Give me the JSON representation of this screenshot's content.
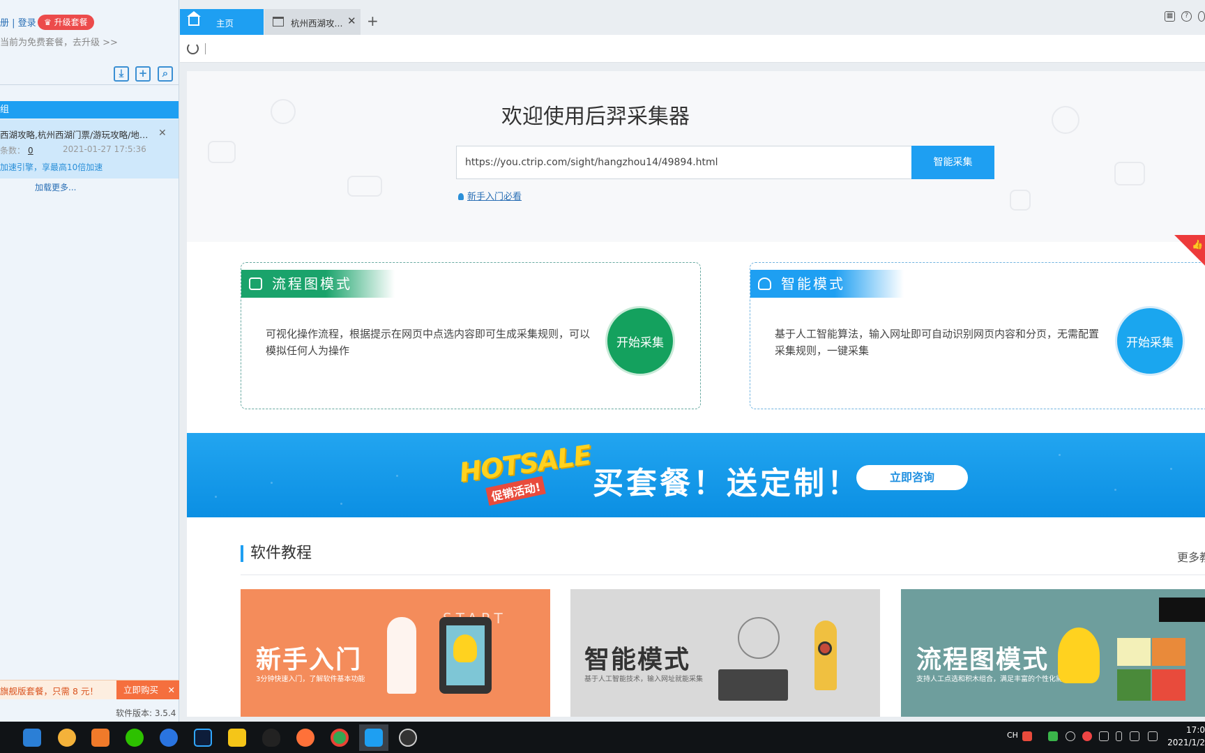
{
  "sidebar": {
    "account_links": "册 | 登录",
    "upgrade_label": "升级套餐",
    "plan_status": "当前为免费套餐，去升级 >>",
    "toolbar": [
      "download-icon",
      "add-icon",
      "search-icon"
    ],
    "group_label": "组",
    "task": {
      "title": "西湖攻略,杭州西湖门票/游玩攻略/地址/...",
      "count_label": "条数：",
      "count_value": "0",
      "time": "2021-01-27 17:5:36",
      "tip": "加速引擎，享最高10倍加速"
    },
    "load_more": "加载更多...",
    "promo_text": "旗舰版套餐，只需 8 元！",
    "buy_label": "立即购买",
    "version": "软件版本: 3.5.4"
  },
  "tabs": [
    {
      "label": "主页",
      "icon": "home-icon",
      "active": true
    },
    {
      "label": "杭州西湖攻...",
      "icon": "page-icon",
      "active": false
    }
  ],
  "main": {
    "title": "欢迎使用后羿采集器",
    "url_value": "https://you.ctrip.com/sight/hangzhou14/49894.html",
    "collect_button": "智能采集",
    "guide_link": "新手入门必看",
    "modes": [
      {
        "name": "流程图模式",
        "description": "可视化操作流程，根据提示在网页中点选内容即可生成采集规则，可以模拟任何人为操作",
        "start_label": "开始采集",
        "color": "#14a15e"
      },
      {
        "name": "智能模式",
        "description": "基于人工智能算法，输入网址即可自动识别网页内容和分页，无需配置采集规则，一键采集",
        "start_label": "开始采集",
        "color": "#1aa6ef"
      }
    ],
    "banner": {
      "hotsale": "HOTSALE",
      "hotsale_sub": "促销活动!",
      "headline": "买套餐！送定制！",
      "cta": "立即咨询"
    },
    "tutorials": {
      "heading": "软件教程",
      "more": "更多教",
      "cards": [
        {
          "title": "新手入门",
          "subtitle": "3分钟快速入门，了解软件基本功能",
          "art_text": "START"
        },
        {
          "title": "智能模式",
          "subtitle": "基于人工智能技术，输入网址就能采集"
        },
        {
          "title": "流程图模式",
          "subtitle": "支持人工点选和积木组合，满足丰富的个性化需求"
        }
      ]
    }
  },
  "taskbar": {
    "apps": [
      "windows-explorer-icon",
      "media-player-icon",
      "app-icon",
      "wechat-icon",
      "browser-b-icon",
      "photoshop-icon",
      "g-app-icon",
      "qq-icon",
      "firefox-icon",
      "chrome-icon",
      "houyi-collector-icon",
      "obs-icon"
    ],
    "ime": "CH",
    "clock_time": "17:0",
    "clock_date": "2021/1/2"
  },
  "colors": {
    "accent": "#1e9ff2",
    "flow_green": "#14a15e",
    "promo_orange": "#f56f3e",
    "upgrade_red": "#ec4b4b"
  }
}
